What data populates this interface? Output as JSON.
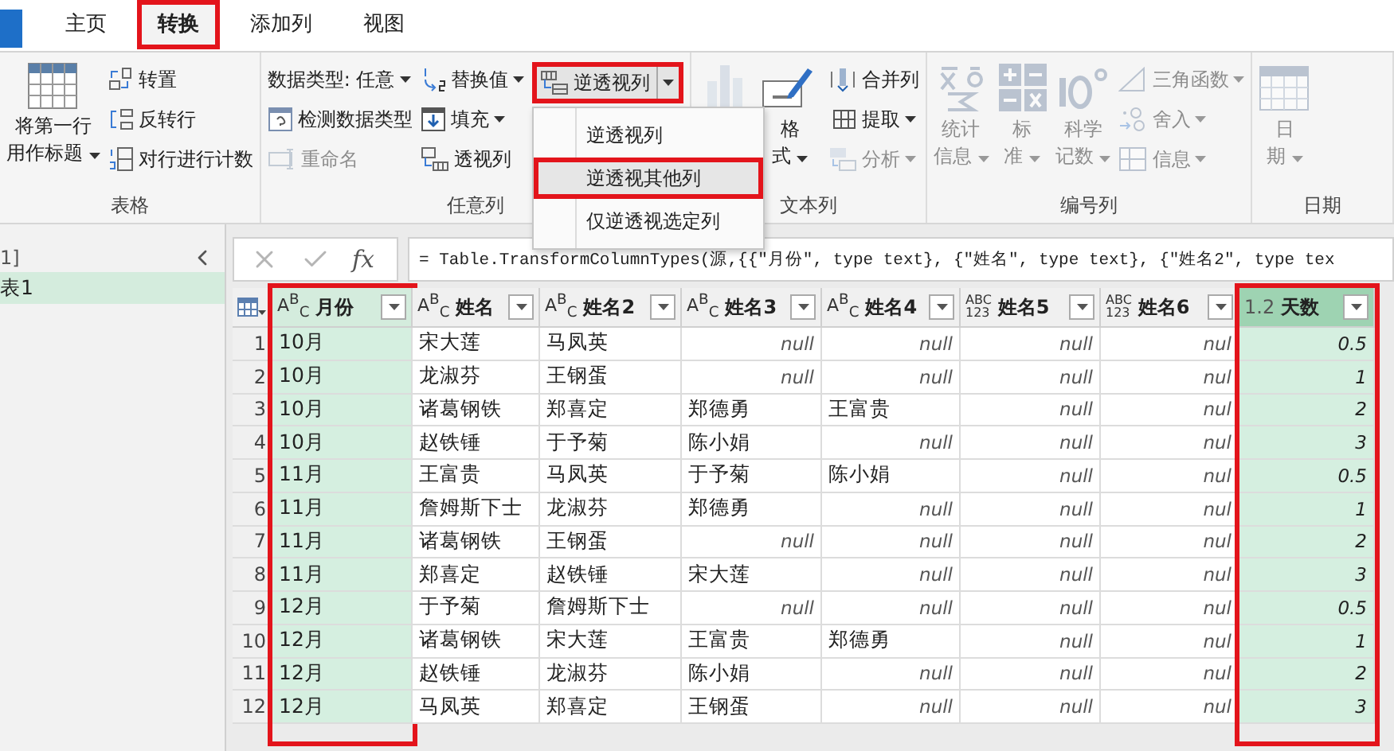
{
  "app_tabs": [
    {
      "label": "主页",
      "selected": false,
      "highlighted": false
    },
    {
      "label": "转换",
      "selected": true,
      "highlighted": true
    },
    {
      "label": "添加列",
      "selected": false,
      "highlighted": false
    },
    {
      "label": "视图",
      "selected": false,
      "highlighted": false
    }
  ],
  "ribbon": {
    "groups": [
      {
        "label": "表格",
        "columns": [
          [
            {
              "kind": "large",
              "lines": [
                "将第一行",
                "用作标题"
              ],
              "dropdown": true,
              "disabled": false
            }
          ],
          [
            {
              "kind": "small",
              "lines": [
                "转置"
              ],
              "dropdown": false,
              "disabled": false
            },
            {
              "kind": "small",
              "lines": [
                "反转行"
              ],
              "dropdown": false,
              "disabled": false
            },
            {
              "kind": "small",
              "lines": [
                "对行进行计数"
              ],
              "dropdown": false,
              "disabled": false
            }
          ]
        ]
      },
      {
        "label": "任意列",
        "columns": [
          [
            {
              "kind": "small",
              "lines": [
                "数据类型: 任意"
              ],
              "dropdown": true,
              "disabled": false
            },
            {
              "kind": "small",
              "lines": [
                "检测数据类型"
              ],
              "dropdown": false,
              "disabled": false
            },
            {
              "kind": "small",
              "lines": [
                "重命名"
              ],
              "dropdown": false,
              "disabled": true
            }
          ],
          [
            {
              "kind": "small",
              "lines": [
                "替换值"
              ],
              "dropdown": true,
              "disabled": false
            },
            {
              "kind": "small",
              "lines": [
                "填充"
              ],
              "dropdown": true,
              "disabled": false
            },
            {
              "kind": "small",
              "lines": [
                "透视列"
              ],
              "dropdown": false,
              "disabled": false
            }
          ],
          [
            {
              "kind": "split",
              "lines": [
                "逆透视列"
              ],
              "dropdown": true,
              "disabled": false,
              "highlighted": true,
              "menu": [
                {
                  "label": "逆透视列",
                  "selected": false,
                  "highlighted": false
                },
                {
                  "label": "逆透视其他列",
                  "selected": true,
                  "highlighted": true
                },
                {
                  "label": "仅逆透视选定列",
                  "selected": false,
                  "highlighted": false
                }
              ]
            }
          ]
        ]
      },
      {
        "label": "文本列",
        "columns": [
          [
            {
              "kind": "icon",
              "dropdown": false,
              "disabled": true
            }
          ],
          [
            {
              "kind": "large",
              "lines": [
                "格",
                "式"
              ],
              "dropdown": true,
              "disabled": false
            }
          ],
          [
            {
              "kind": "small",
              "lines": [
                "合并列"
              ],
              "dropdown": false,
              "disabled": false
            },
            {
              "kind": "small",
              "lines": [
                "提取"
              ],
              "dropdown": true,
              "disabled": false
            },
            {
              "kind": "small",
              "lines": [
                "分析"
              ],
              "dropdown": true,
              "disabled": true
            }
          ]
        ]
      },
      {
        "label": "编号列",
        "columns": [
          [
            {
              "kind": "large",
              "lines": [
                "统计",
                "信息"
              ],
              "dropdown": true,
              "disabled": true
            }
          ],
          [
            {
              "kind": "large",
              "lines": [
                "标",
                "准"
              ],
              "dropdown": true,
              "disabled": true
            }
          ],
          [
            {
              "kind": "large",
              "lines": [
                "科学",
                "记数"
              ],
              "dropdown": true,
              "disabled": true
            }
          ],
          [
            {
              "kind": "small",
              "lines": [
                "三角函数"
              ],
              "dropdown": true,
              "disabled": true
            },
            {
              "kind": "small",
              "lines": [
                "舍入"
              ],
              "dropdown": true,
              "disabled": true
            },
            {
              "kind": "small",
              "lines": [
                "信息"
              ],
              "dropdown": true,
              "disabled": true
            }
          ]
        ]
      },
      {
        "label": "日期",
        "columns": [
          [
            {
              "kind": "large",
              "lines": [
                "日",
                "期"
              ],
              "dropdown": true,
              "disabled": true
            }
          ]
        ]
      }
    ]
  },
  "queries": {
    "header": "1]",
    "items": [
      {
        "label": "表1",
        "selected": true
      }
    ]
  },
  "formula_bar": {
    "function_label": "fx",
    "text": "= Table.TransformColumnTypes(源,{{\"月份\", type text}, {\"姓名\", type text}, {\"姓名2\", type tex"
  },
  "table": {
    "columns": [
      {
        "kind": "any",
        "type_label": "A$^{B}$$_{C}$",
        "name": "月份",
        "selected": true,
        "focused": false,
        "highlighted": true
      },
      {
        "kind": "any",
        "type_label": "A$^{B}$$_{C}$",
        "name": "姓名",
        "selected": false,
        "focused": false,
        "highlighted": false
      },
      {
        "kind": "any",
        "type_label": "A$^{B}$$_{C}$",
        "name": "姓名2",
        "selected": false,
        "focused": false,
        "highlighted": false
      },
      {
        "kind": "any",
        "type_label": "A$^{B}$$_{C}$",
        "name": "姓名3",
        "selected": false,
        "focused": false,
        "highlighted": false
      },
      {
        "kind": "any",
        "type_label": "A$^{B}$$_{C}$",
        "name": "姓名4",
        "selected": false,
        "focused": false,
        "highlighted": false
      },
      {
        "kind": "stacked",
        "type_label": "ABC 123",
        "name": "姓名5",
        "selected": false,
        "focused": false,
        "highlighted": false
      },
      {
        "kind": "stacked",
        "type_label": "ABC 123",
        "name": "姓名6",
        "selected": false,
        "focused": false,
        "highlighted": false
      },
      {
        "kind": "decimal",
        "type_label": "1.2",
        "name": "天数",
        "selected": true,
        "focused": true,
        "highlighted": true
      }
    ],
    "rows": [
      {
        "number": "1",
        "cells": [
          {
            "text": "10月",
            "kind": "text"
          },
          {
            "text": "宋大莲",
            "kind": "text"
          },
          {
            "text": "马凤英",
            "kind": "text"
          },
          {
            "text": "null",
            "kind": "null"
          },
          {
            "text": "null",
            "kind": "null"
          },
          {
            "text": "null",
            "kind": "null"
          },
          {
            "text": "nul",
            "kind": "null"
          },
          {
            "text": "0.5",
            "kind": "number"
          }
        ]
      },
      {
        "number": "2",
        "cells": [
          {
            "text": "10月",
            "kind": "text"
          },
          {
            "text": "龙淑芬",
            "kind": "text"
          },
          {
            "text": "王钢蛋",
            "kind": "text"
          },
          {
            "text": "null",
            "kind": "null"
          },
          {
            "text": "null",
            "kind": "null"
          },
          {
            "text": "null",
            "kind": "null"
          },
          {
            "text": "nul",
            "kind": "null"
          },
          {
            "text": "1",
            "kind": "number"
          }
        ]
      },
      {
        "number": "3",
        "cells": [
          {
            "text": "10月",
            "kind": "text"
          },
          {
            "text": "诸葛钢铁",
            "kind": "text"
          },
          {
            "text": "郑喜定",
            "kind": "text"
          },
          {
            "text": "郑德勇",
            "kind": "text"
          },
          {
            "text": "王富贵",
            "kind": "text"
          },
          {
            "text": "null",
            "kind": "null"
          },
          {
            "text": "nul",
            "kind": "null"
          },
          {
            "text": "2",
            "kind": "number"
          }
        ]
      },
      {
        "number": "4",
        "cells": [
          {
            "text": "10月",
            "kind": "text"
          },
          {
            "text": "赵铁锤",
            "kind": "text"
          },
          {
            "text": "于予菊",
            "kind": "text"
          },
          {
            "text": "陈小娟",
            "kind": "text"
          },
          {
            "text": "null",
            "kind": "null"
          },
          {
            "text": "null",
            "kind": "null"
          },
          {
            "text": "nul",
            "kind": "null"
          },
          {
            "text": "3",
            "kind": "number"
          }
        ]
      },
      {
        "number": "5",
        "cells": [
          {
            "text": "11月",
            "kind": "text"
          },
          {
            "text": "王富贵",
            "kind": "text"
          },
          {
            "text": "马凤英",
            "kind": "text"
          },
          {
            "text": "于予菊",
            "kind": "text"
          },
          {
            "text": "陈小娟",
            "kind": "text"
          },
          {
            "text": "null",
            "kind": "null"
          },
          {
            "text": "nul",
            "kind": "null"
          },
          {
            "text": "0.5",
            "kind": "number"
          }
        ]
      },
      {
        "number": "6",
        "cells": [
          {
            "text": "11月",
            "kind": "text"
          },
          {
            "text": "詹姆斯下士",
            "kind": "text"
          },
          {
            "text": "龙淑芬",
            "kind": "text"
          },
          {
            "text": "郑德勇",
            "kind": "text"
          },
          {
            "text": "null",
            "kind": "null"
          },
          {
            "text": "null",
            "kind": "null"
          },
          {
            "text": "nul",
            "kind": "null"
          },
          {
            "text": "1",
            "kind": "number"
          }
        ]
      },
      {
        "number": "7",
        "cells": [
          {
            "text": "11月",
            "kind": "text"
          },
          {
            "text": "诸葛钢铁",
            "kind": "text"
          },
          {
            "text": "王钢蛋",
            "kind": "text"
          },
          {
            "text": "null",
            "kind": "null"
          },
          {
            "text": "null",
            "kind": "null"
          },
          {
            "text": "null",
            "kind": "null"
          },
          {
            "text": "nul",
            "kind": "null"
          },
          {
            "text": "2",
            "kind": "number"
          }
        ]
      },
      {
        "number": "8",
        "cells": [
          {
            "text": "11月",
            "kind": "text"
          },
          {
            "text": "郑喜定",
            "kind": "text"
          },
          {
            "text": "赵铁锤",
            "kind": "text"
          },
          {
            "text": "宋大莲",
            "kind": "text"
          },
          {
            "text": "null",
            "kind": "null"
          },
          {
            "text": "null",
            "kind": "null"
          },
          {
            "text": "nul",
            "kind": "null"
          },
          {
            "text": "3",
            "kind": "number"
          }
        ]
      },
      {
        "number": "9",
        "cells": [
          {
            "text": "12月",
            "kind": "text"
          },
          {
            "text": "于予菊",
            "kind": "text"
          },
          {
            "text": "詹姆斯下士",
            "kind": "text"
          },
          {
            "text": "null",
            "kind": "null"
          },
          {
            "text": "null",
            "kind": "null"
          },
          {
            "text": "null",
            "kind": "null"
          },
          {
            "text": "nul",
            "kind": "null"
          },
          {
            "text": "0.5",
            "kind": "number"
          }
        ]
      },
      {
        "number": "10",
        "cells": [
          {
            "text": "12月",
            "kind": "text"
          },
          {
            "text": "诸葛钢铁",
            "kind": "text"
          },
          {
            "text": "宋大莲",
            "kind": "text"
          },
          {
            "text": "王富贵",
            "kind": "text"
          },
          {
            "text": "郑德勇",
            "kind": "text"
          },
          {
            "text": "null",
            "kind": "null"
          },
          {
            "text": "nul",
            "kind": "null"
          },
          {
            "text": "1",
            "kind": "number"
          }
        ]
      },
      {
        "number": "11",
        "cells": [
          {
            "text": "12月",
            "kind": "text"
          },
          {
            "text": "赵铁锤",
            "kind": "text"
          },
          {
            "text": "龙淑芬",
            "kind": "text"
          },
          {
            "text": "陈小娟",
            "kind": "text"
          },
          {
            "text": "null",
            "kind": "null"
          },
          {
            "text": "null",
            "kind": "null"
          },
          {
            "text": "nul",
            "kind": "null"
          },
          {
            "text": "2",
            "kind": "number"
          }
        ]
      },
      {
        "number": "12",
        "cells": [
          {
            "text": "12月",
            "kind": "text"
          },
          {
            "text": "马凤英",
            "kind": "text"
          },
          {
            "text": "郑喜定",
            "kind": "text"
          },
          {
            "text": "王钢蛋",
            "kind": "text"
          },
          {
            "text": "null",
            "kind": "null"
          },
          {
            "text": "null",
            "kind": "null"
          },
          {
            "text": "nul",
            "kind": "null"
          },
          {
            "text": "3",
            "kind": "number"
          }
        ]
      }
    ]
  }
}
